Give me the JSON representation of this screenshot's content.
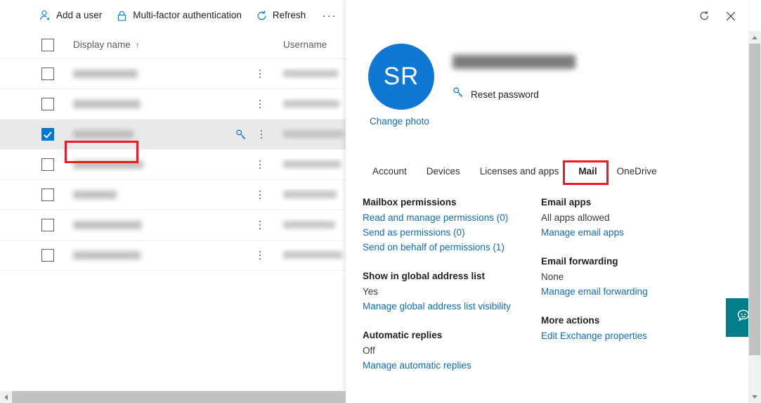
{
  "command_bar": {
    "buttons": [
      {
        "label": "Add a user",
        "icon": "add-user-icon"
      },
      {
        "label": "Multi-factor authentication",
        "icon": "lock-icon"
      },
      {
        "label": "Refresh",
        "icon": "refresh-icon"
      }
    ],
    "overflow_label": "···"
  },
  "table": {
    "columns": [
      {
        "key": "display_name",
        "label": "Display name",
        "sorted": true,
        "sort_arrow": "↑"
      },
      {
        "key": "username",
        "label": "Username"
      }
    ],
    "rows": [
      {
        "display_name": "",
        "username": "",
        "selected": false,
        "name_width": 92,
        "user_width": 78
      },
      {
        "display_name": "",
        "username": "",
        "selected": false,
        "name_width": 96,
        "user_width": 80
      },
      {
        "display_name": "",
        "username": "",
        "selected": true,
        "name_width": 86,
        "user_width": 86
      },
      {
        "display_name": "",
        "username": "",
        "selected": false,
        "name_width": 100,
        "user_width": 82
      },
      {
        "display_name": "",
        "username": "",
        "selected": false,
        "name_width": 62,
        "user_width": 76
      },
      {
        "display_name": "",
        "username": "",
        "selected": false,
        "name_width": 98,
        "user_width": 74
      },
      {
        "display_name": "",
        "username": "",
        "selected": false,
        "name_width": 96,
        "user_width": 84
      }
    ]
  },
  "detail_panel": {
    "refresh_icon": "refresh-icon",
    "close_icon": "close-icon",
    "avatar_initials": "SR",
    "avatar_color": "#0f78d4",
    "change_photo_label": "Change photo",
    "reset_password_label": "Reset password",
    "reset_password_icon": "key-icon",
    "tabs": [
      {
        "label": "Account",
        "active": false
      },
      {
        "label": "Devices",
        "active": false
      },
      {
        "label": "Licenses and apps",
        "active": false
      },
      {
        "label": "Mail",
        "active": true
      },
      {
        "label": "OneDrive",
        "active": false
      }
    ],
    "left_column": [
      {
        "title": "Mailbox permissions",
        "value": null,
        "links": [
          "Read and manage permissions (0)",
          "Send as permissions (0)",
          "Send on behalf of permissions (1)"
        ]
      },
      {
        "title": "Show in global address list",
        "value": "Yes",
        "links": [
          "Manage global address list visibility"
        ]
      },
      {
        "title": "Automatic replies",
        "value": "Off",
        "links": [
          "Manage automatic replies"
        ]
      }
    ],
    "right_column": [
      {
        "title": "Email apps",
        "value": "All apps allowed",
        "links": [
          "Manage email apps"
        ]
      },
      {
        "title": "Email forwarding",
        "value": "None",
        "links": [
          "Manage email forwarding"
        ]
      },
      {
        "title": "More actions",
        "value": null,
        "links": [
          "Edit Exchange properties"
        ]
      }
    ]
  },
  "feedback": {
    "icon": "feedback-smiley-icon",
    "color": "#007e8a"
  },
  "annotations": {
    "highlight_color": "#ee1b24",
    "boxes": [
      "selected-row-name",
      "mail-tab"
    ]
  },
  "scrollbars": {
    "vertical": {
      "up_icon": "arrow-up-icon",
      "down_icon": "arrow-down-icon"
    },
    "horizontal": {
      "left_icon": "arrow-left-icon"
    }
  }
}
